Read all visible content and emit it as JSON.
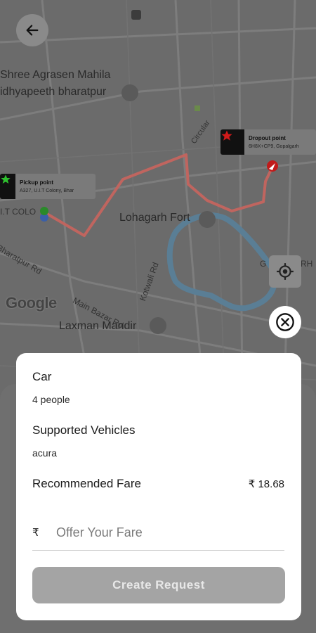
{
  "map": {
    "labels": {
      "school_line1": "Shree Agrasen Mahila",
      "school_line2": "idhyapeeth bharatpur",
      "circular": "Circular",
      "uit": "I.T COLO",
      "fort": "Lohagarh Fort",
      "bharatpur_rd": "Bharatpur Rd",
      "main_bazar": "Main Bazar Rd",
      "kotwali": "Kotwali Rd",
      "laxman": "Laxman Mandir",
      "gopal": "G",
      "rh": "RH"
    },
    "google_logo": "Google",
    "pickup": {
      "title": "Pickup point",
      "address": "A327, U.I.T Colony, Bhar"
    },
    "dropout": {
      "title": "Dropout point",
      "address": "6H8X+CP9, Gopalgarh"
    }
  },
  "details": {
    "vehicle_type": "Car",
    "capacity": "4 people",
    "supported_title": "Supported Vehicles",
    "supported_value": "acura",
    "fare_title": "Recommended Fare",
    "fare_value": "₹ 18.68",
    "currency_symbol": "₹",
    "fare_placeholder": "Offer Your Fare",
    "create_label": "Create Request"
  },
  "colors": {
    "route": "#c0655f",
    "water": "#5a7e95",
    "accent_pickup": "#2ec02e",
    "accent_drop": "#d11a1a"
  }
}
